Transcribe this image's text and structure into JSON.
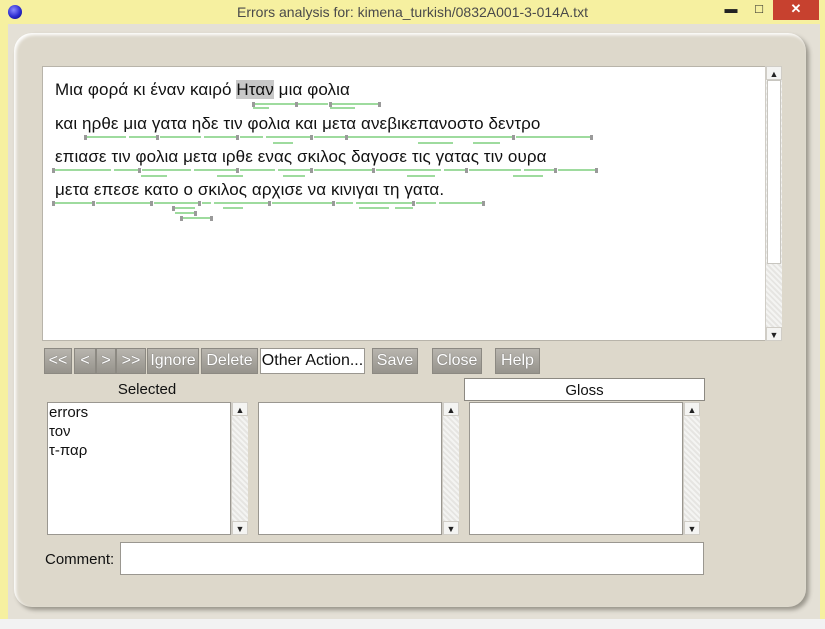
{
  "window": {
    "title": "Errors analysis for: kimena_turkish/0832A001-3-014A.txt",
    "minimize": "▬",
    "maximize": "□",
    "close": "✕"
  },
  "text_lines": [
    {
      "before": "Μια φορά κι έναν καιρό ",
      "highlight": "Ηταν",
      "after": " μια φολια"
    },
    {
      "before": "και ηρθε μια γατα ηδε τιν φολια και μετα ανεβικεπανοστο δεντρο",
      "highlight": "",
      "after": ""
    },
    {
      "before": "επιασε τιν φολια μετα ιρθε ενας σκιλος δαγοσε τις γατας τιν ουρα",
      "highlight": "",
      "after": ""
    },
    {
      "before": "μετα επεσε κατο ο σκιλος αρχισε να κινιγαι τη γατα.",
      "highlight": "",
      "after": ""
    }
  ],
  "toolbar": {
    "first": "<<",
    "prev": "<",
    "next": ">",
    "last": ">>",
    "ignore": "Ignore",
    "delete": "Delete",
    "other_action": "Other Action...",
    "save": "Save",
    "close": "Close",
    "help": "Help"
  },
  "columns": {
    "selected_header": "Selected",
    "gloss_header": "Gloss"
  },
  "selected_list": [
    "errors",
    "τον",
    "τ-παρ"
  ],
  "middle_list": [],
  "gloss_list": [],
  "comment": {
    "label": "Comment:",
    "value": ""
  },
  "colors": {
    "title_bar": "#f6f0a0",
    "close_button": "#c7412f",
    "panel": "#ddd8cb",
    "error_mark": "#7ecf7e",
    "highlight": "#c8c8c8"
  }
}
